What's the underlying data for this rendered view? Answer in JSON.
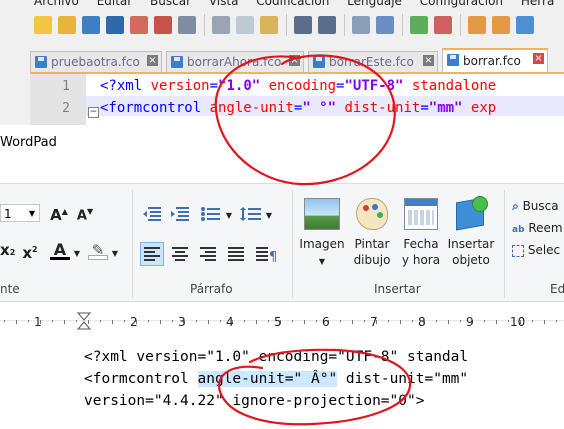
{
  "npp": {
    "menu": [
      "Archivo",
      "Editar",
      "Buscar",
      "Vista",
      "Codificación",
      "Lenguaje",
      "Configuración",
      "Herra"
    ],
    "tabs": [
      {
        "label": "pruebaotra.fco"
      },
      {
        "label": "borrarAhora.fco"
      },
      {
        "label": "borrarEste.fco"
      },
      {
        "label": "borrar.fco"
      }
    ],
    "line_numbers": [
      "1",
      "2"
    ],
    "line1": {
      "open": "<?xml ",
      "a1": "version",
      "eq1": "=",
      "v1": "\"1.0\"",
      "a2": " encoding",
      "eq2": "=",
      "v2": "\"UTF-8\"",
      "a3": " standalone"
    },
    "line2": {
      "open": "<formcontrol ",
      "a1": "angle-unit",
      "eq1": "=",
      "v1": "\" °\"",
      "a2": " dist-unit",
      "eq2": "=",
      "v2": "\"mm\"",
      "a3": " exp"
    }
  },
  "wordpad": {
    "title": "WordPad",
    "font_size": "1",
    "group_labels": {
      "font": "nte",
      "paragraph": "Párrafo",
      "insert": "Insertar",
      "edit": "Ed"
    },
    "insert_buttons": {
      "image": "Imagen",
      "paint_l1": "Pintar",
      "paint_l2": "dibujo",
      "datetime_l1": "Fecha",
      "datetime_l2": "y hora",
      "object_l1": "Insertar",
      "object_l2": "objeto"
    },
    "edit_buttons": {
      "find": "Busca",
      "replace": "Reem",
      "select": "Selec"
    },
    "ruler_ticks": [
      "1",
      "2",
      "3",
      "4",
      "5",
      "6",
      "7",
      "8",
      "9",
      "10"
    ],
    "doc": {
      "line1": "<?xml version=\"1.0\" encoding=\"UTF-8\" standal",
      "line2_pre": "<formcontrol ",
      "line2_sel": "angle-unit=\" Â°\"",
      "line2_post": " dist-unit=\"mm\"",
      "line3": "version=\"4.4.22\" ignore-projection=\"0\">"
    }
  },
  "colors": {
    "npp_tag": "#0000ff",
    "npp_attr": "#ff0000",
    "npp_value": "#8000ff",
    "active_tab_accent": "#f8b058",
    "annotation": "#e0161e",
    "selection": "#cce8ff"
  }
}
